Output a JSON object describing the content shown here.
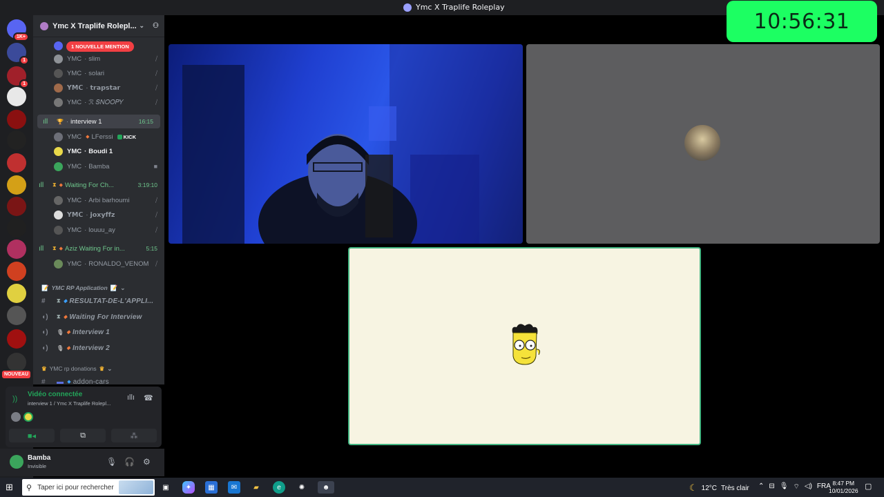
{
  "window": {
    "title": "Ymc X Traplife Roleplay"
  },
  "clock": "10:56:31",
  "rail": {
    "servers": [
      {
        "color": "#5865f2",
        "badge": "1K+"
      },
      {
        "color": "#3b4a9a",
        "badge": "1"
      },
      {
        "color": "#a0202a",
        "badge": "1"
      },
      {
        "color": "#e8e8e8",
        "badge": ""
      },
      {
        "color": "#8a1010",
        "badge": ""
      },
      {
        "color": "#222222",
        "badge": ""
      },
      {
        "color": "#c03030",
        "badge": ""
      },
      {
        "color": "#d4a017",
        "badge": ""
      },
      {
        "color": "#7a1515",
        "badge": ""
      },
      {
        "color": "#202020",
        "badge": ""
      },
      {
        "color": "#b03060",
        "badge": ""
      },
      {
        "color": "#d04020",
        "badge": ""
      },
      {
        "color": "#e0d040",
        "badge": ""
      },
      {
        "color": "#555555",
        "badge": ""
      },
      {
        "color": "#a01010",
        "badge": ""
      },
      {
        "color": "#333333",
        "badge": ""
      }
    ],
    "nouveau_label": "NOUVEAU"
  },
  "sidebar": {
    "server_name": "Ymc X Traplife Rolepl...",
    "mention_pill": "1 NOUVELLE MENTION",
    "members_top": [
      {
        "prefix": "YMC",
        "name": "slim"
      },
      {
        "prefix": "YMC",
        "name": "solari"
      },
      {
        "prefix": "𝗬𝗠𝗖",
        "name": "𝘁𝗿𝗮𝗽𝘀𝘁𝗮𝗿"
      },
      {
        "prefix": "YMC",
        "name": "ℛ 𝑆𝑁𝑂𝑂𝑃𝑌"
      }
    ],
    "voice_interview1": {
      "name": "interview 1",
      "timer": "16:15"
    },
    "members_interview1": [
      {
        "prefix": "YMC",
        "name": "LFerssi",
        "tag": "KICK"
      },
      {
        "prefix": "YMC",
        "name": "Boudi 1"
      },
      {
        "prefix": "YMC",
        "name": "Bamba"
      }
    ],
    "voice_waiting": {
      "name": "Waiting For Ch...",
      "timer": "3:19:10"
    },
    "members_waiting": [
      {
        "prefix": "YMC",
        "name": "Arbi barhoumi"
      },
      {
        "prefix": "𝗬𝗠𝗖",
        "name": "𝗷𝗼𝘅𝘆𝗳𝗳𝘇"
      },
      {
        "prefix": "YMC",
        "name": "louuu_ay"
      }
    ],
    "voice_aziz": {
      "name": "Aziz Waiting For in...",
      "timer": "5:15"
    },
    "members_aziz": [
      {
        "prefix": "YMC",
        "name": "RONALDO_VENOM"
      }
    ],
    "category_app": "YMC RP Application",
    "text_channels": [
      {
        "name": "RESULTAT-DE-L'APPLI..."
      },
      {
        "name": "Waiting For Interview"
      },
      {
        "name": "Interview 1"
      },
      {
        "name": "Interview 2"
      }
    ],
    "category_donations": "YMC rp donations",
    "donation_channel": "addon-cars"
  },
  "voice_panel": {
    "status": "Vidéo connectée",
    "subtitle": "interview 1 / Ymc X Traplife Rolepl..."
  },
  "user": {
    "name": "Bamba",
    "status": "Invisible"
  },
  "taskbar": {
    "search_placeholder": "Taper ici pour rechercher",
    "weather_temp": "12°C",
    "weather_desc": "Très clair",
    "lang": "FRA",
    "time": "8:47 PM",
    "date": "10/01/2026"
  },
  "colors": {
    "accent_green": "#1cff62",
    "voice_green": "#23a55a",
    "mention_red": "#f23f43",
    "tile_border": "#43b581"
  }
}
